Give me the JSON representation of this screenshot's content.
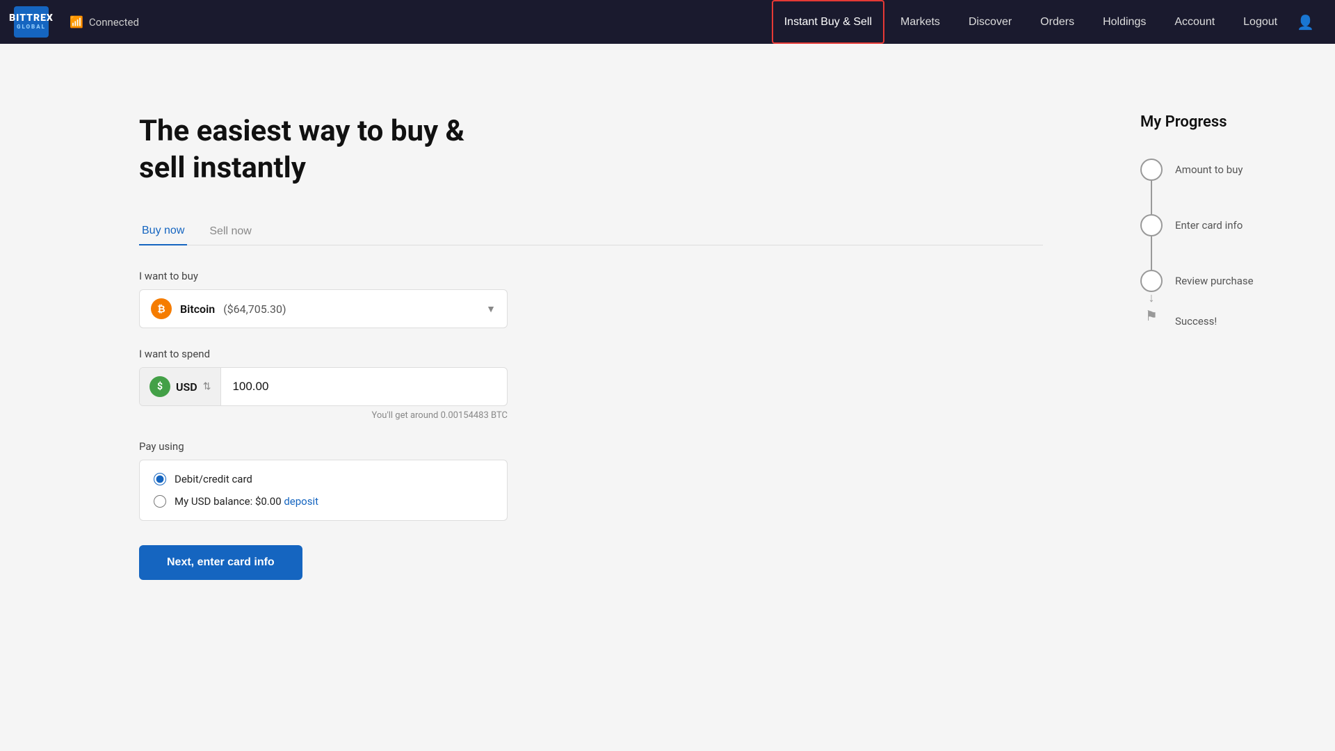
{
  "nav": {
    "logo_top": "BITTREX",
    "logo_bottom": "GLOBAL",
    "connection_status": "Connected",
    "links": [
      {
        "label": "Instant Buy & Sell",
        "key": "instant-buy-sell",
        "active": true
      },
      {
        "label": "Markets",
        "key": "markets",
        "active": false
      },
      {
        "label": "Discover",
        "key": "discover",
        "active": false
      },
      {
        "label": "Orders",
        "key": "orders",
        "active": false
      },
      {
        "label": "Holdings",
        "key": "holdings",
        "active": false
      },
      {
        "label": "Account",
        "key": "account",
        "active": false
      },
      {
        "label": "Logout",
        "key": "logout",
        "active": false
      }
    ]
  },
  "hero": {
    "title": "The easiest way to buy & sell instantly"
  },
  "tabs": [
    {
      "label": "Buy now",
      "active": true
    },
    {
      "label": "Sell now",
      "active": false
    }
  ],
  "form": {
    "buy_label": "I want to buy",
    "coin_name": "Bitcoin",
    "coin_price": "($64,705.30)",
    "spend_label": "I want to spend",
    "currency": "USD",
    "amount": "100.00",
    "conversion_hint": "You'll get around 0.00154483 BTC",
    "pay_label": "Pay using",
    "pay_options": [
      {
        "label": "Debit/credit card",
        "checked": true
      },
      {
        "label": "My USD balance: $0.00",
        "checked": false,
        "link_text": "deposit",
        "has_link": true
      }
    ],
    "next_button": "Next, enter card info"
  },
  "progress": {
    "title": "My Progress",
    "steps": [
      {
        "label": "Amount to buy",
        "type": "circle"
      },
      {
        "label": "Enter card info",
        "type": "circle"
      },
      {
        "label": "Review purchase",
        "type": "circle"
      },
      {
        "label": "Success!",
        "type": "flag"
      }
    ]
  }
}
